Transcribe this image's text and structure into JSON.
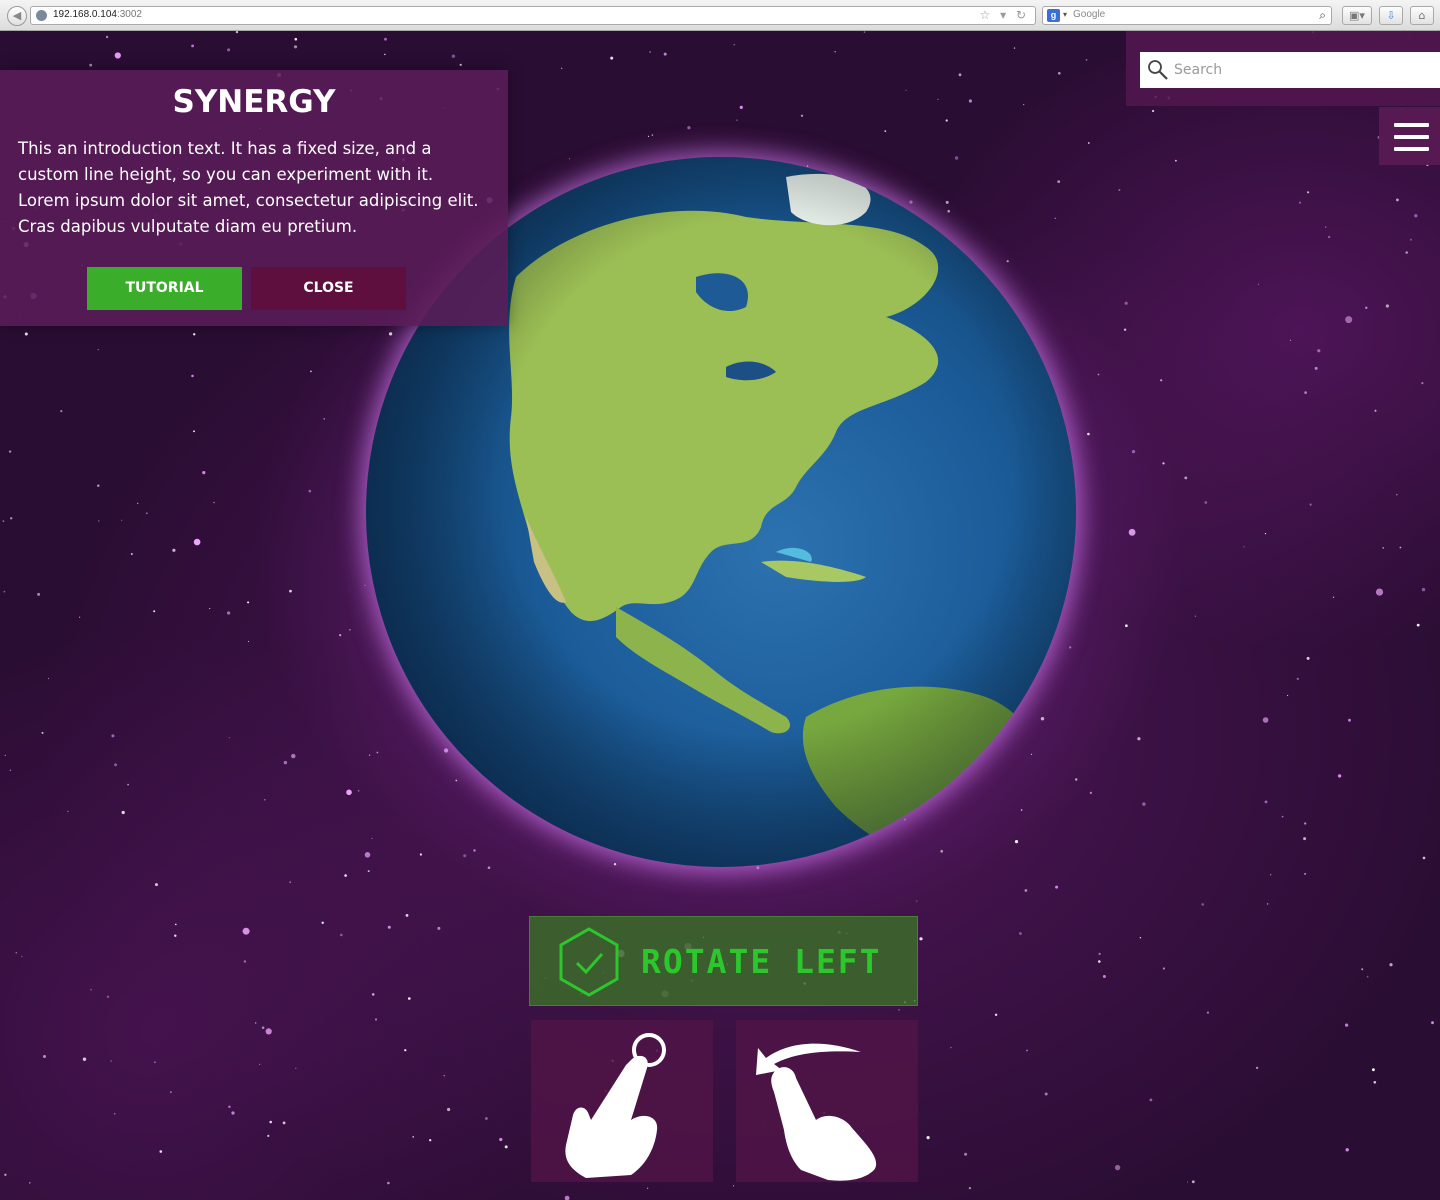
{
  "browser": {
    "url_host": "192.168.0.104",
    "url_port": ":3002",
    "search_engine": "Google",
    "search_engine_icon": "g-icon"
  },
  "intro": {
    "title": "SYNERGY",
    "text": "This an introduction text. It has a fixed size, and a custom line height, so you can experiment with it. Lorem ipsum dolor sit amet, consectetur adipiscing elit. Cras dapibus vulputate diam eu pretium.",
    "tutorial_label": "TUTORIAL",
    "close_label": "CLOSE"
  },
  "search": {
    "placeholder": "Search"
  },
  "gesture": {
    "label": "ROTATE LEFT"
  },
  "colors": {
    "panel": "#5a1c58",
    "tutorial_button": "#3aad2b",
    "close_button": "#5e0f3e",
    "rotate_text": "#2cc72c",
    "ocean": "#1b5c99",
    "land": "#8fb84a"
  }
}
